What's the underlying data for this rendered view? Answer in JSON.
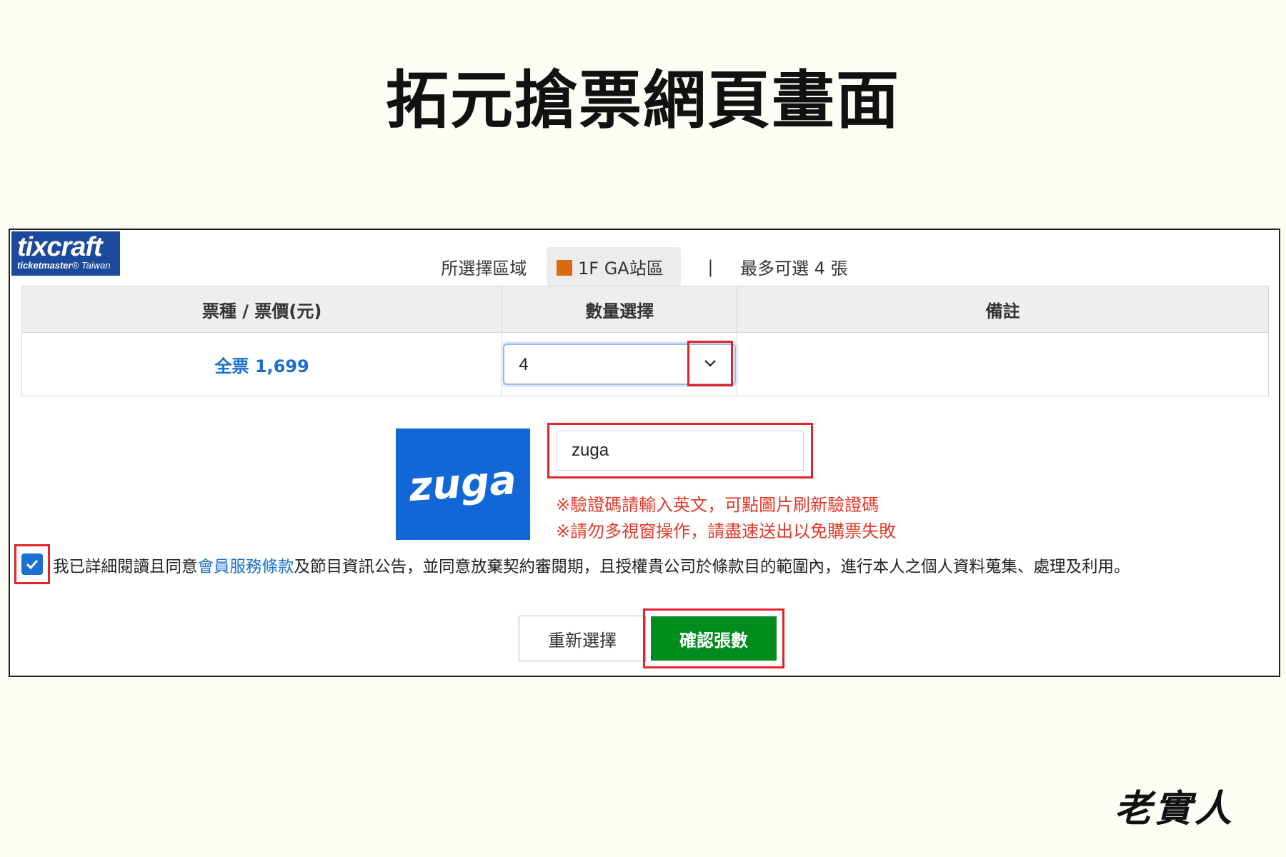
{
  "page": {
    "title": "拓元搶票網頁畫面",
    "signature": "老實人"
  },
  "logo": {
    "main": "tixcraft",
    "sub_brand": "ticketmaster",
    "sub_region": "Taiwan"
  },
  "area": {
    "label": "所選擇區域",
    "zone": "1F GA站區",
    "zone_color": "#d96a0f",
    "separator": "|",
    "max_label": "最多可選 4 張"
  },
  "table": {
    "headers": [
      "票種 / 票價(元)",
      "數量選擇",
      "備註"
    ],
    "rows": [
      {
        "ticket": "全票 1,699",
        "quantity": "4",
        "note": ""
      }
    ]
  },
  "captcha": {
    "image_text": "zuga",
    "input_value": "zuga",
    "notices": [
      "※驗證碼請輸入英文，可點圖片刷新驗證碼",
      "※請勿多視窗操作，請盡速送出以免購票失敗"
    ]
  },
  "agreement": {
    "checked": true,
    "text_before": "我已詳細閱讀且同意",
    "link": "會員服務條款",
    "text_after": "及節目資訊公告，並同意放棄契約審閱期，且授權貴公司於條款目的範圍內，進行本人之個人資料蒐集、處理及利用。"
  },
  "buttons": {
    "reset": "重新選擇",
    "confirm": "確認張數"
  },
  "colors": {
    "accent_blue": "#1a6fd0",
    "confirm_green": "#008d1e",
    "highlight_red": "#e1242c",
    "captcha_blue": "#1167d6"
  }
}
